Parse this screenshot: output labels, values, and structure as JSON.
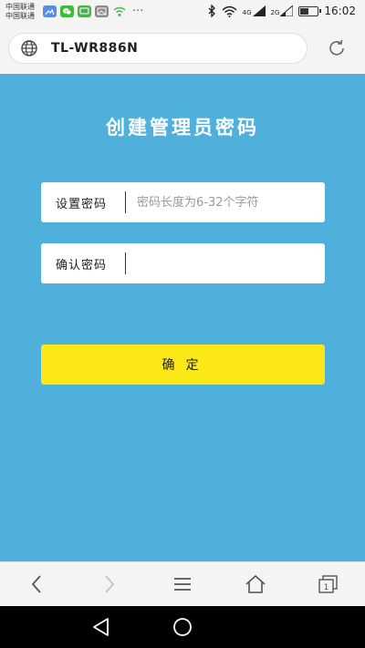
{
  "status_bar": {
    "carrier_line1": "中国联通",
    "carrier_line2": "中国联通",
    "notification_icons": [
      "photo-icon",
      "wechat-icon",
      "message-icon",
      "image-icon",
      "wifi-share-icon"
    ],
    "more": "···",
    "network_1": "4G",
    "network_2": "2G",
    "battery_level": 0.45,
    "time": "16:02"
  },
  "address_bar": {
    "url": "TL-WR886N"
  },
  "form": {
    "title": "创建管理员密码",
    "password_label": "设置密码",
    "password_placeholder": "密码长度为6-32个字符",
    "confirm_label": "确认密码",
    "confirm_placeholder": "",
    "submit_label": "确定"
  },
  "colors": {
    "background": "#4fb0dc",
    "button": "#fce816"
  },
  "toolbar": [
    "back-icon",
    "forward-icon",
    "menu-icon",
    "home-icon",
    "tabs-icon"
  ],
  "toolbar_tab_count": "1",
  "system_nav": [
    "nav-back-icon",
    "nav-home-icon"
  ]
}
